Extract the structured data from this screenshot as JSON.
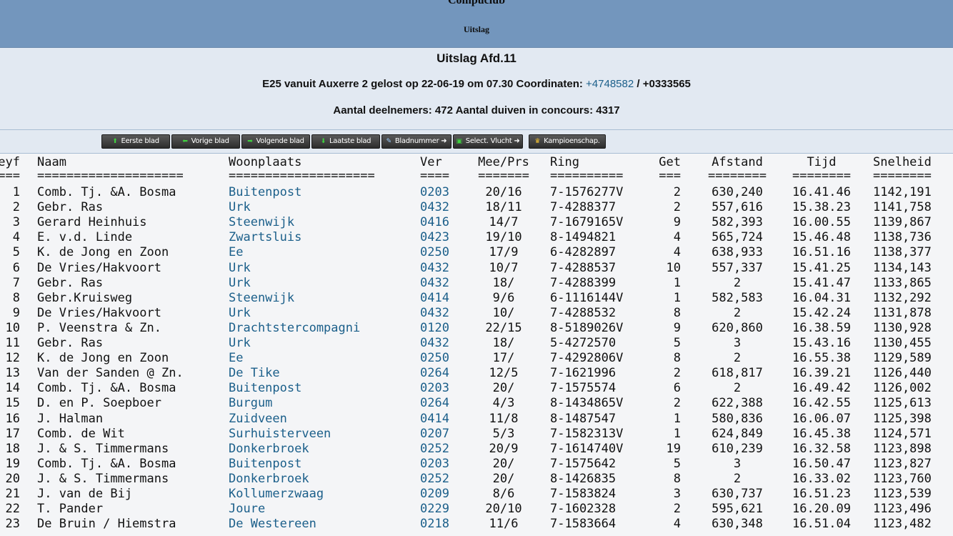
{
  "banner": {
    "club": "Compuclub",
    "subtitle": "Uitslag"
  },
  "info": {
    "title": "Uitslag Afd.11",
    "race_prefix": "E25 vanuit Auxerre 2 gelost op 22-06-19 om 07.30 Coordinaten:",
    "coord_lat": "+4748582",
    "coord_sep": " / ",
    "coord_lon": "+0333565",
    "participants": "Aantal deelnemers: 472 Aantal duiven in concours: 4317"
  },
  "toolbar": [
    {
      "name": "first-page-button",
      "icon": "up-arrow-icon",
      "glyph": "⬆",
      "cls": "ic",
      "label": "Eerste blad"
    },
    {
      "name": "prev-page-button",
      "icon": "left-arrow-icon",
      "glyph": "⬅",
      "cls": "ic",
      "label": "Vorige blad"
    },
    {
      "name": "next-page-button",
      "icon": "right-arrow-icon",
      "glyph": "➡",
      "cls": "ic",
      "label": "Volgende blad"
    },
    {
      "name": "last-page-button",
      "icon": "down-arrow-icon",
      "glyph": "⬇",
      "cls": "ic",
      "label": "Laatste blad"
    },
    {
      "name": "page-number-button",
      "icon": "magnifier-icon",
      "glyph": "✎",
      "cls": "ic b",
      "label": "Bladnummer ➜"
    },
    {
      "name": "select-flight-button",
      "icon": "select-icon",
      "glyph": "▣",
      "cls": "ic",
      "label": "Select. Vlucht ➜"
    },
    {
      "name": "championship-button",
      "icon": "crown-icon",
      "glyph": "♛",
      "cls": "ic y",
      "label": "Kampioenschap."
    }
  ],
  "table": {
    "headers": {
      "rank": "eyf",
      "naam": "Naam",
      "woonplaats": "Woonplaats",
      "ver": "Ver",
      "meeprs": "Mee/Prs",
      "ring": "Ring",
      "get": "Get",
      "afstand": "Afstand",
      "tijd": "Tijd",
      "snelheid": "Snelheid"
    },
    "separators": {
      "rank": "===",
      "naam": "====================",
      "woonplaats": "====================",
      "ver": "====",
      "meeprs": "=======",
      "ring": "==========",
      "get": "===",
      "afstand": "========",
      "tijd": "========",
      "snelheid": "========"
    },
    "rows": [
      {
        "rank": "1",
        "naam": "Comb. Tj. &A. Bosma",
        "woonplaats": "Buitenpost",
        "ver": "0203",
        "meeprs": "20/16",
        "ring": "7-1576277V",
        "get": "2",
        "afstand": "630,240",
        "tijd": "16.41.46",
        "snelheid": "1142,191"
      },
      {
        "rank": "2",
        "naam": "Gebr. Ras",
        "woonplaats": "Urk",
        "ver": "0432",
        "meeprs": "18/11",
        "ring": "7-4288377",
        "get": "2",
        "afstand": "557,616",
        "tijd": "15.38.23",
        "snelheid": "1141,758"
      },
      {
        "rank": "3",
        "naam": "Gerard Heinhuis",
        "woonplaats": "Steenwijk",
        "ver": "0416",
        "meeprs": "14/7",
        "ring": "7-1679165V",
        "get": "9",
        "afstand": "582,393",
        "tijd": "16.00.55",
        "snelheid": "1139,867"
      },
      {
        "rank": "4",
        "naam": "E. v.d. Linde",
        "woonplaats": "Zwartsluis",
        "ver": "0423",
        "meeprs": "19/10",
        "ring": "8-1494821",
        "get": "4",
        "afstand": "565,724",
        "tijd": "15.46.48",
        "snelheid": "1138,736"
      },
      {
        "rank": "5",
        "naam": "K. de Jong en Zoon",
        "woonplaats": "Ee",
        "ver": "0250",
        "meeprs": "17/9",
        "ring": "6-4282897",
        "get": "4",
        "afstand": "638,933",
        "tijd": "16.51.16",
        "snelheid": "1138,377"
      },
      {
        "rank": "6",
        "naam": "De Vries/Hakvoort",
        "woonplaats": "Urk",
        "ver": "0432",
        "meeprs": "10/7",
        "ring": "7-4288537",
        "get": "10",
        "afstand": "557,337",
        "tijd": "15.41.25",
        "snelheid": "1134,143"
      },
      {
        "rank": "7",
        "naam": "Gebr. Ras",
        "woonplaats": "Urk",
        "ver": "0432",
        "meeprs": "18/",
        "ring": "7-4288399",
        "get": "1",
        "afstand": "2",
        "tijd": "15.41.47",
        "snelheid": "1133,865"
      },
      {
        "rank": "8",
        "naam": "Gebr.Kruisweg",
        "woonplaats": "Steenwijk",
        "ver": "0414",
        "meeprs": "9/6",
        "ring": "6-1116144V",
        "get": "1",
        "afstand": "582,583",
        "tijd": "16.04.31",
        "snelheid": "1132,292"
      },
      {
        "rank": "9",
        "naam": "De Vries/Hakvoort",
        "woonplaats": "Urk",
        "ver": "0432",
        "meeprs": "10/",
        "ring": "7-4288532",
        "get": "8",
        "afstand": "2",
        "tijd": "15.42.24",
        "snelheid": "1131,878"
      },
      {
        "rank": "10",
        "naam": "P. Veenstra & Zn.",
        "woonplaats": "Drachtstercompagni",
        "ver": "0120",
        "meeprs": "22/15",
        "ring": "8-5189026V",
        "get": "9",
        "afstand": "620,860",
        "tijd": "16.38.59",
        "snelheid": "1130,928"
      },
      {
        "rank": "11",
        "naam": "Gebr. Ras",
        "woonplaats": "Urk",
        "ver": "0432",
        "meeprs": "18/",
        "ring": "5-4272570",
        "get": "5",
        "afstand": "3",
        "tijd": "15.43.16",
        "snelheid": "1130,455"
      },
      {
        "rank": "12",
        "naam": "K. de Jong en Zoon",
        "woonplaats": "Ee",
        "ver": "0250",
        "meeprs": "17/",
        "ring": "7-4292806V",
        "get": "8",
        "afstand": "2",
        "tijd": "16.55.38",
        "snelheid": "1129,589"
      },
      {
        "rank": "13",
        "naam": "Van der Sanden @ Zn.",
        "woonplaats": "De Tike",
        "ver": "0264",
        "meeprs": "12/5",
        "ring": "7-1621996",
        "get": "2",
        "afstand": "618,817",
        "tijd": "16.39.21",
        "snelheid": "1126,440"
      },
      {
        "rank": "14",
        "naam": "Comb. Tj. &A. Bosma",
        "woonplaats": "Buitenpost",
        "ver": "0203",
        "meeprs": "20/",
        "ring": "7-1575574",
        "get": "6",
        "afstand": "2",
        "tijd": "16.49.42",
        "snelheid": "1126,002"
      },
      {
        "rank": "15",
        "naam": "D. en P. Soepboer",
        "woonplaats": "Burgum",
        "ver": "0264",
        "meeprs": "4/3",
        "ring": "8-1434865V",
        "get": "2",
        "afstand": "622,388",
        "tijd": "16.42.55",
        "snelheid": "1125,613"
      },
      {
        "rank": "16",
        "naam": "J. Halman",
        "woonplaats": "Zuidveen",
        "ver": "0414",
        "meeprs": "11/8",
        "ring": "8-1487547",
        "get": "1",
        "afstand": "580,836",
        "tijd": "16.06.07",
        "snelheid": "1125,398"
      },
      {
        "rank": "17",
        "naam": "Comb. de Wit",
        "woonplaats": "Surhuisterveen",
        "ver": "0207",
        "meeprs": "5/3",
        "ring": "7-1582313V",
        "get": "1",
        "afstand": "624,849",
        "tijd": "16.45.38",
        "snelheid": "1124,571"
      },
      {
        "rank": "18",
        "naam": "J. & S. Timmermans",
        "woonplaats": "Donkerbroek",
        "ver": "0252",
        "meeprs": "20/9",
        "ring": "7-1614740V",
        "get": "19",
        "afstand": "610,239",
        "tijd": "16.32.58",
        "snelheid": "1123,898"
      },
      {
        "rank": "19",
        "naam": "Comb. Tj. &A. Bosma",
        "woonplaats": "Buitenpost",
        "ver": "0203",
        "meeprs": "20/",
        "ring": "7-1575642",
        "get": "5",
        "afstand": "3",
        "tijd": "16.50.47",
        "snelheid": "1123,827"
      },
      {
        "rank": "20",
        "naam": "J. & S. Timmermans",
        "woonplaats": "Donkerbroek",
        "ver": "0252",
        "meeprs": "20/",
        "ring": "8-1426835",
        "get": "8",
        "afstand": "2",
        "tijd": "16.33.02",
        "snelheid": "1123,760"
      },
      {
        "rank": "21",
        "naam": "J. van de Bij",
        "woonplaats": "Kollumerzwaag",
        "ver": "0209",
        "meeprs": "8/6",
        "ring": "7-1583824",
        "get": "3",
        "afstand": "630,737",
        "tijd": "16.51.23",
        "snelheid": "1123,539"
      },
      {
        "rank": "22",
        "naam": "T. Pander",
        "woonplaats": "Joure",
        "ver": "0229",
        "meeprs": "20/10",
        "ring": "7-1602328",
        "get": "2",
        "afstand": "595,621",
        "tijd": "16.20.09",
        "snelheid": "1123,496"
      },
      {
        "rank": "23",
        "naam": "De Bruin / Hiemstra",
        "woonplaats": "De Westereen",
        "ver": "0218",
        "meeprs": "11/6",
        "ring": "7-1583664",
        "get": "4",
        "afstand": "630,348",
        "tijd": "16.51.04",
        "snelheid": "1123,482"
      }
    ]
  }
}
